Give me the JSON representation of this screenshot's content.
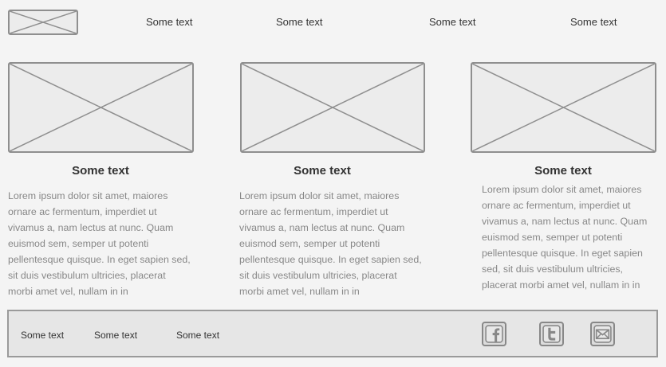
{
  "header": {
    "nav": [
      "Some text",
      "Some text",
      "Some text",
      "Some text"
    ]
  },
  "columns": [
    {
      "title": "Some text",
      "body": "Lorem ipsum dolor sit amet, maiores ornare ac fermentum, imperdiet ut vivamus a, nam lectus at nunc. Quam euismod sem, semper ut potenti pellentesque quisque. In eget sapien sed, sit duis vestibulum ultricies, placerat morbi amet vel, nullam in in"
    },
    {
      "title": "Some text",
      "body": "Lorem ipsum dolor sit amet, maiores ornare ac fermentum, imperdiet ut vivamus a, nam lectus at nunc. Quam euismod sem, semper ut potenti pellentesque quisque. In eget sapien sed, sit duis vestibulum ultricies, placerat morbi amet vel, nullam in in"
    },
    {
      "title": "Some text",
      "body": "Lorem ipsum dolor sit amet, maiores ornare ac fermentum, imperdiet ut vivamus a, nam lectus at nunc. Quam euismod sem, semper ut potenti pellentesque quisque. In eget sapien sed, sit duis vestibulum ultricies, placerat morbi amet vel, nullam in in"
    }
  ],
  "footer": {
    "links": [
      "Some text",
      "Some text",
      "Some text"
    ],
    "social_icons": [
      "facebook-icon",
      "twitter-icon",
      "email-icon"
    ]
  },
  "colors": {
    "background": "#f4f4f4",
    "placeholder_fill": "#ececec",
    "placeholder_stroke": "#8f8f8f",
    "body_text": "#888888",
    "heading_text": "#333333"
  }
}
